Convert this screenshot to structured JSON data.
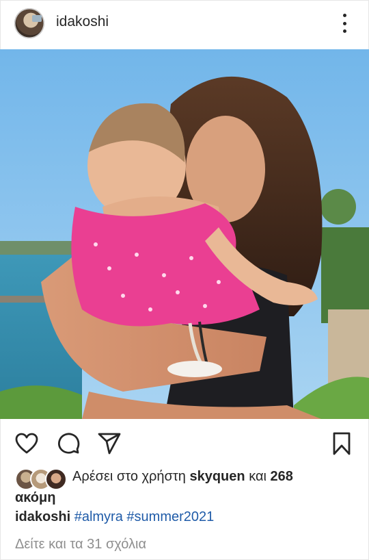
{
  "post": {
    "username": "idakoshi",
    "more_icon": "more-vertical-icon"
  },
  "actions": {
    "like_icon": "heart-icon",
    "comment_icon": "comment-icon",
    "share_icon": "send-icon",
    "save_icon": "bookmark-icon"
  },
  "likes": {
    "prefix": "Αρέσει στο χρήστη",
    "user": "skyquen",
    "conj": "και",
    "count": "268",
    "suffix": "ακόμη"
  },
  "caption": {
    "username": "idakoshi",
    "tag1": "#almyra",
    "tag2": "#summer2021"
  },
  "comments": {
    "label": "Δείτε και τα 31 σχόλια"
  },
  "colors": {
    "text": "#262626",
    "hashtag": "#1f5ba8",
    "muted": "#8e8e8e"
  }
}
